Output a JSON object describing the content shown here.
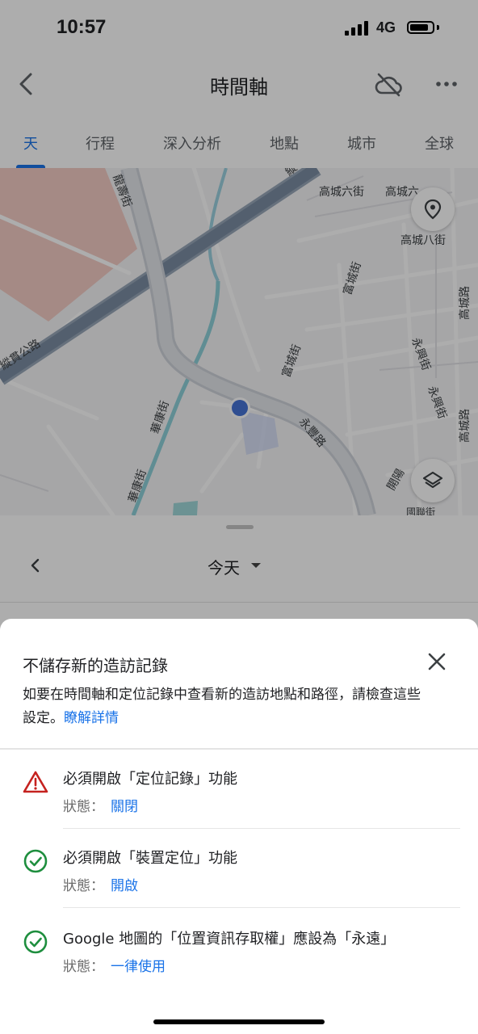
{
  "status_bar": {
    "time": "10:57",
    "network": "4G"
  },
  "app_bar": {
    "title": "時間軸",
    "back_icon": "back-arrow-icon",
    "cloud_icon": "cloud-off-icon",
    "more_icon": "more-horiz-icon"
  },
  "tabs": [
    {
      "label": "天",
      "active": true
    },
    {
      "label": "行程",
      "active": false
    },
    {
      "label": "深入分析",
      "active": false
    },
    {
      "label": "地點",
      "active": false
    },
    {
      "label": "城市",
      "active": false
    },
    {
      "label": "全球",
      "active": false
    }
  ],
  "map": {
    "labels": [
      "龍壽街",
      "縱貫公路",
      "華康街",
      "華康街",
      "高城六街",
      "高城六",
      "高城八街",
      "富城街",
      "富城街",
      "永興街",
      "永興街",
      "永豐路",
      "高城路",
      "高城路",
      "開陽",
      "國聯街",
      "縱"
    ],
    "accent_color": "#4674d6"
  },
  "day_panel": {
    "label": "今天"
  },
  "sheet": {
    "title": "不儲存新的造訪記錄",
    "description": "如要在時間軸和定位記錄中查看新的造訪地點和路徑，請檢查這些設定。",
    "learn_more": "瞭解詳情",
    "status_prefix": "狀態：",
    "items": [
      {
        "title": "必須開啟「定位記錄」功能",
        "status_value": "關閉",
        "icon": "warning-icon",
        "color": "#c5221f"
      },
      {
        "title": "必須開啟「裝置定位」功能",
        "status_value": "開啟",
        "icon": "check-circle-icon",
        "color": "#1e8e3e"
      },
      {
        "title": "Google 地圖的「位置資訊存取權」應設為「永遠」",
        "status_value": "一律使用",
        "icon": "check-circle-icon",
        "color": "#1e8e3e"
      }
    ]
  }
}
